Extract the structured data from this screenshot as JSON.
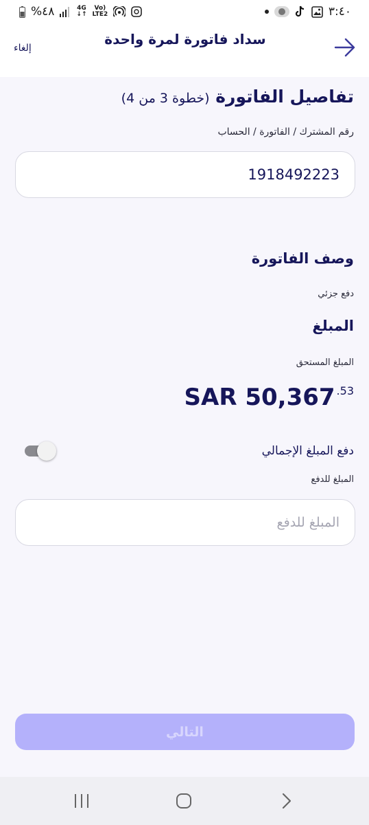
{
  "status_bar": {
    "battery": "%٤٨",
    "network_top": "4G",
    "network_bottom": "LTE2",
    "volte": "Vo)",
    "time": "٣:٤٠"
  },
  "header": {
    "title": "سداد فاتورة لمرة واحدة",
    "cancel": "إلغاء"
  },
  "main": {
    "step_title": "تفاصيل الفاتورة",
    "step_count": "(خطوة 3 من 4)",
    "account_label": "رقم المشترك / الفاتورة / الحساب",
    "account_value": "1918492223",
    "bill_description_title": "وصف الفاتورة",
    "payment_type": "دفع جزئي",
    "amount_title": "المبلغ",
    "amount_due_label": "المبلغ المستحق",
    "amount_due_main": "SAR 50,367",
    "amount_due_cents": ".53",
    "pay_total_label": "دفع المبلغ الإجمالي",
    "pay_total_enabled": false,
    "amount_to_pay_label": "المبلغ للدفع",
    "amount_to_pay_placeholder": "المبلغ للدفع",
    "next_button": "التالي"
  },
  "colors": {
    "primary_text": "#16165a",
    "button_disabled": "#b4b1fb",
    "background": "#f7f6fc"
  }
}
